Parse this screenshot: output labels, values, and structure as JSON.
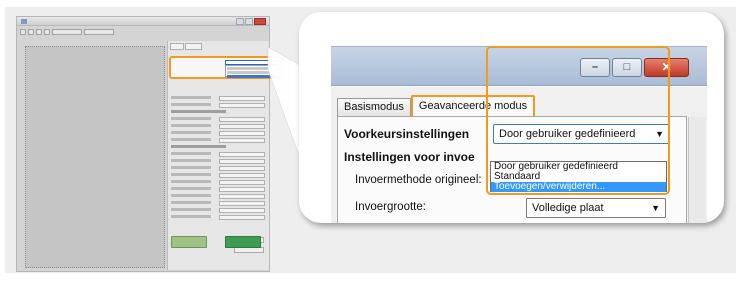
{
  "callout": {
    "tabs": [
      {
        "label": "Basismodus",
        "active": false
      },
      {
        "label": "Geavanceerde modus",
        "active": true
      }
    ],
    "window_buttons": {
      "minimize": "–",
      "maximize": "□",
      "close": "✕"
    },
    "preferences": {
      "label": "Voorkeursinstellingen",
      "selected": "Door gebruiker gedefinieerd",
      "options": [
        "Door gebruiker gedefinieerd",
        "Standaard",
        "Toevoegen/verwijderen..."
      ],
      "highlighted_option": "Toevoegen/verwijderen..."
    },
    "input_settings_label": "Instellingen voor invoe",
    "input_method_label": "Invoermethode origineel:",
    "input_size": {
      "label": "Invoergrootte:",
      "value": "Volledige plaat"
    }
  },
  "icons": {
    "dropdown_arrow": "▼"
  },
  "colors": {
    "highlight": "#f39a1e",
    "selection": "#3399ff",
    "close_button": "#c03a27",
    "scan_button": "#3f9c54",
    "preview_button": "#9fc286"
  }
}
